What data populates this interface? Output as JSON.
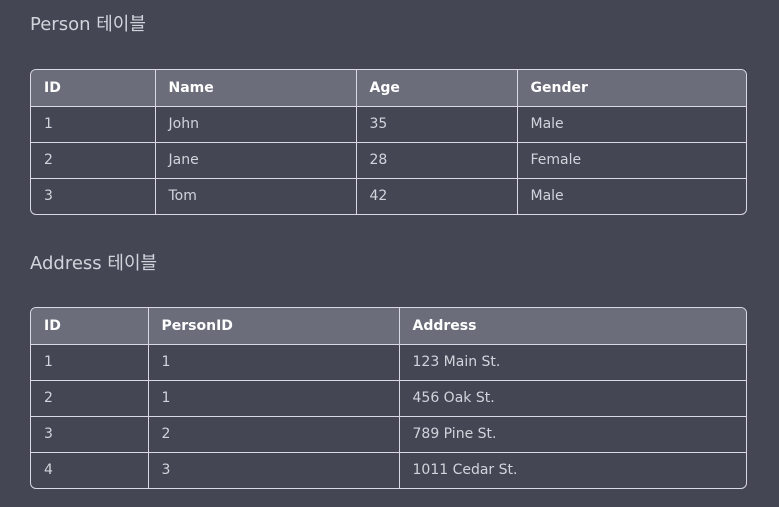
{
  "person": {
    "title": "Person 테이블",
    "headers": [
      "ID",
      "Name",
      "Age",
      "Gender"
    ],
    "rows": [
      [
        "1",
        "John",
        "35",
        "Male"
      ],
      [
        "2",
        "Jane",
        "28",
        "Female"
      ],
      [
        "3",
        "Tom",
        "42",
        "Male"
      ]
    ]
  },
  "address": {
    "title": "Address 테이블",
    "headers": [
      "ID",
      "PersonID",
      "Address"
    ],
    "rows": [
      [
        "1",
        "1",
        "123 Main St."
      ],
      [
        "2",
        "1",
        "456 Oak St."
      ],
      [
        "3",
        "2",
        "789 Pine St."
      ],
      [
        "4",
        "3",
        "1011 Cedar St."
      ]
    ]
  }
}
